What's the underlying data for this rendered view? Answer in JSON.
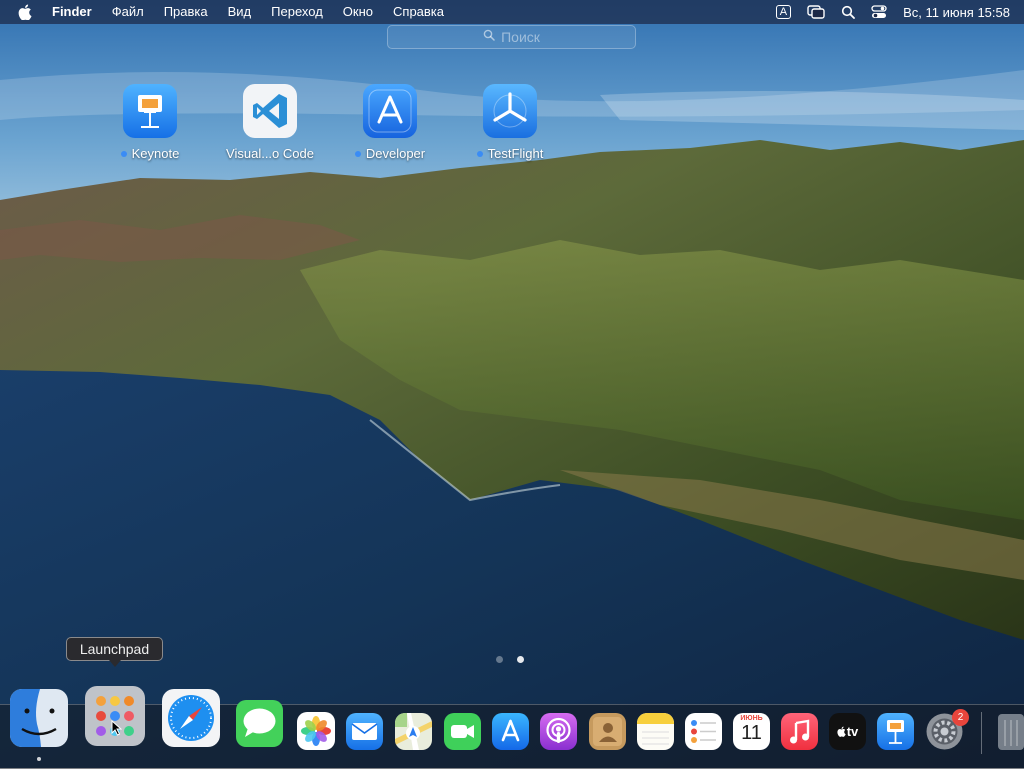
{
  "menubar": {
    "app_name": "Finder",
    "menus": [
      "Файл",
      "Правка",
      "Вид",
      "Переход",
      "Окно",
      "Справка"
    ],
    "input_indicator": "A",
    "datetime": "Вс, 11 июня  15:58"
  },
  "launchpad": {
    "search_placeholder": "Поиск",
    "apps": [
      {
        "label": "Keynote",
        "icon": "keynote-icon",
        "new": true
      },
      {
        "label": "Visual...o Code",
        "icon": "vscode-icon",
        "new": false
      },
      {
        "label": "Developer",
        "icon": "developer-icon",
        "new": true
      },
      {
        "label": "TestFlight",
        "icon": "testflight-icon",
        "new": true
      }
    ],
    "pages": 2,
    "current_page": 2
  },
  "tooltip": "Launchpad",
  "dock": {
    "items": [
      "finder-icon",
      "launchpad-icon",
      "safari-icon",
      "messages-icon",
      "photos-icon",
      "mail-icon",
      "maps-icon",
      "facetime-icon",
      "app-store-icon",
      "podcasts-icon",
      "contacts-icon",
      "notes-icon",
      "reminders-icon",
      "calendar-icon",
      "music-icon",
      "apple-tv-icon",
      "keynote-icon",
      "system-preferences-icon",
      "trash-icon"
    ],
    "calendar_month": "ИЮНЬ",
    "calendar_day": "11",
    "tv_label": "tv",
    "settings_badge": "2"
  }
}
